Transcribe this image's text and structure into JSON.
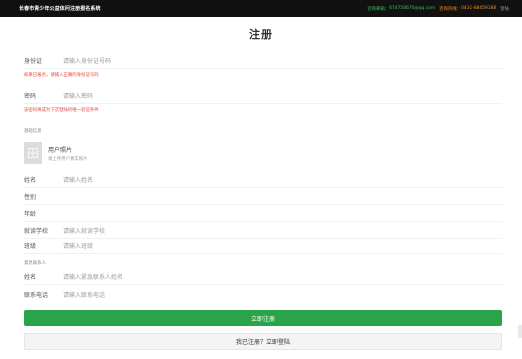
{
  "header": {
    "site_name": "长春市青少年公益体问注册报名系统",
    "email_label": "咨询邮箱：",
    "email": "674758670@qq.com",
    "phone_label": "咨询热线：",
    "phone": "0431-88459188",
    "login_link": "登陆"
  },
  "page_title": "注册",
  "form": {
    "id_label": "身份证",
    "id_placeholder": "请输入身份证号码",
    "id_hint": "如果已报名，请输入正确的身份证号码",
    "password_label": "密码",
    "password_placeholder": "请输入密码",
    "password_hint": "该密码将成为下次登陆的唯一验证条件",
    "basic_info_section": "基础信息",
    "photo_title": "用户照片",
    "photo_hint": "请上传用户真实照片",
    "name_label": "姓名",
    "name_placeholder": "请输入姓名",
    "gender_label": "性别",
    "age_label": "年龄",
    "school_label": "就读学校",
    "school_placeholder": "请输入就读学校",
    "class_label": "班级",
    "class_placeholder": "请输入班级",
    "emergency_section": "紧急联系人",
    "contact_name_label": "姓名",
    "contact_name_placeholder": "请输入紧急联系人姓名",
    "contact_phone_label": "联系电话",
    "contact_phone_placeholder": "请输入联系电话"
  },
  "buttons": {
    "register": "立即注册",
    "login": "我已注册？立即登陆"
  },
  "colors": {
    "accent_green": "#2aa44a",
    "hint_red": "#e2483d",
    "topbar_bg": "#111111",
    "phone_orange": "#ff8a1e"
  },
  "icons": {
    "photo_placeholder": "image-icon"
  }
}
